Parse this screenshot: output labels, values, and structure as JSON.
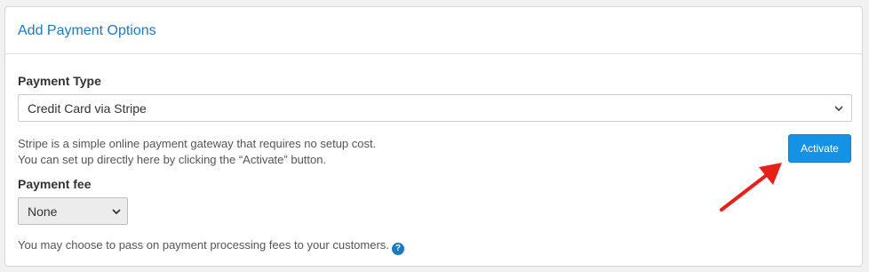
{
  "panel": {
    "title": "Add Payment Options"
  },
  "payment_type": {
    "label": "Payment Type",
    "selected": "Credit Card via Stripe",
    "description_line1": "Stripe is a simple online payment gateway that requires no setup cost.",
    "description_line2": "You can set up directly here by clicking the “Activate” button.",
    "activate_label": "Activate"
  },
  "payment_fee": {
    "label": "Payment fee",
    "selected": "None",
    "help_text": "You may choose to pass on payment processing fees to your customers.",
    "help_icon": "?"
  },
  "icons": {
    "chevron": "chevron-down-icon",
    "help": "question-circle-icon",
    "arrow": "red-arrow-annotation"
  },
  "colors": {
    "title": "#1b7ac4",
    "button": "#1493e6",
    "arrow": "#e8201a"
  }
}
